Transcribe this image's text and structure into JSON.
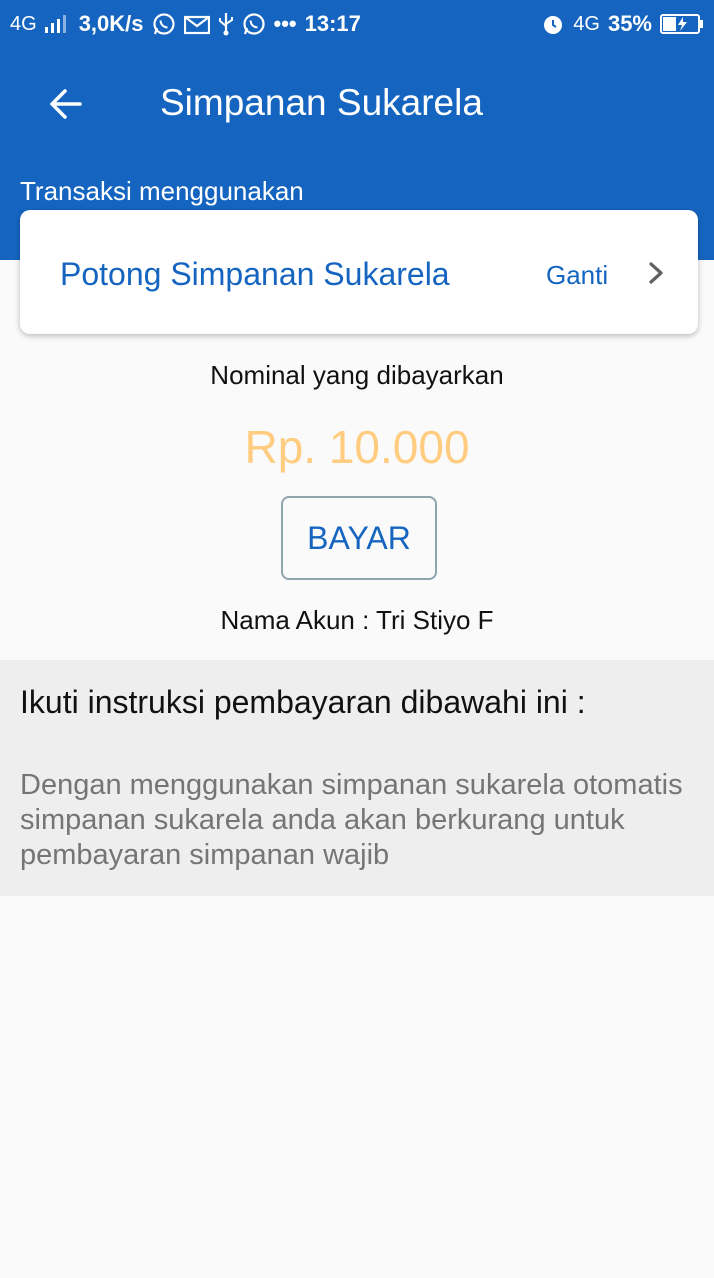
{
  "status_bar": {
    "network_left": "4G",
    "speed": "3,0K/s",
    "dots": "•••",
    "time": "13:17",
    "network_right": "4G",
    "battery": "35%"
  },
  "app_bar": {
    "title": "Simpanan Sukarela",
    "back_icon": "arrow-left-icon",
    "color": "#1565c0"
  },
  "transaction": {
    "label": "Transaksi menggunakan",
    "method": "Potong Simpanan Sukarela",
    "change_label": "Ganti"
  },
  "payment": {
    "nominal_label": "Nominal yang dibayarkan",
    "amount": "Rp. 10.000",
    "amount_color": "#ffcc80",
    "pay_button": "BAYAR",
    "account_name": "Nama Akun : Tri Stiyo F"
  },
  "instructions": {
    "title": "Ikuti instruksi pembayaran dibawahi ini :",
    "body": "Dengan menggunakan simpanan sukarela otomatis simpanan sukarela anda akan berkurang untuk pembayaran simpanan wajib"
  }
}
